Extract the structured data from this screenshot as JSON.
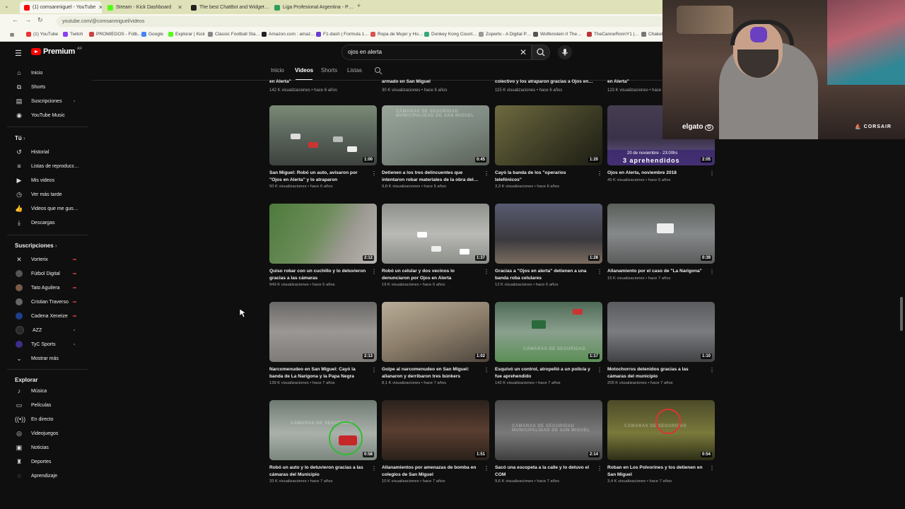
{
  "browser": {
    "tabs": [
      {
        "label": "(1) comsanmiguel - YouTube",
        "color": "#ff0000"
      },
      {
        "label": "Stream - Kick Dashboard",
        "color": "#53fc18"
      },
      {
        "label": "The best ChatBot and Widget…",
        "color": "#222222"
      },
      {
        "label": "Liga Profesional Argentina - P…",
        "color": "#2e9e5a"
      }
    ],
    "url": "youtube.com/@comsanmiguel/videos",
    "bookmarks": [
      "(1) YouTube",
      "Twitch",
      "PROMIEDOS - Fútb…",
      "Google",
      "Explorar | Kick",
      "Classic Football Sta…",
      "Amazon.com : amaz…",
      "F1-dash | Formula 1…",
      "Ropa de Mujer y Ho…",
      "Donkey Kong Count…",
      "Zoperto - A Digital P…",
      "Wolfenstein II The…",
      "TheCanneRonnY1 |…",
      "Chakel"
    ]
  },
  "header": {
    "logo_text": "Premium",
    "country": "AR",
    "search_value": "ojos en alerta"
  },
  "sidebar": {
    "main": [
      {
        "label": "Inicio",
        "icon": "home-icon"
      },
      {
        "label": "Shorts",
        "icon": "shorts-icon"
      },
      {
        "label": "Suscripciones",
        "icon": "subscriptions-icon"
      },
      {
        "label": "YouTube Music",
        "icon": "music-icon"
      }
    ],
    "you_title": "Tú",
    "you": [
      {
        "label": "Historial",
        "icon": "history-icon"
      },
      {
        "label": "Listas de reproducc…",
        "icon": "playlist-icon"
      },
      {
        "label": "Mis videos",
        "icon": "video-icon"
      },
      {
        "label": "Ver más tarde",
        "icon": "clock-icon"
      },
      {
        "label": "Videos que me gus…",
        "icon": "like-icon"
      },
      {
        "label": "Descargas",
        "icon": "download-icon"
      }
    ],
    "subs_title": "Suscripciones",
    "subs": [
      {
        "label": "Vorterix",
        "color": "#222222"
      },
      {
        "label": "Fútbol Digital",
        "color": "#555555"
      },
      {
        "label": "Tato Aguilera",
        "color": "#7a5a48"
      },
      {
        "label": "Cristian Traverso",
        "color": "#666666"
      },
      {
        "label": "Cadena Xeneize",
        "color": "#1e3f8f"
      },
      {
        "label": "AZZ",
        "color": "#2a2a2a"
      },
      {
        "label": "TyC Sports",
        "color": "#3b2f8a"
      }
    ],
    "show_more": "Mostrar más",
    "explore_title": "Explorar",
    "explore": [
      {
        "label": "Música",
        "icon": "music-note-icon"
      },
      {
        "label": "Películas",
        "icon": "film-icon"
      },
      {
        "label": "En directo",
        "icon": "live-icon"
      },
      {
        "label": "Videojuegos",
        "icon": "gamepad-icon"
      },
      {
        "label": "Noticias",
        "icon": "news-icon"
      },
      {
        "label": "Deportes",
        "icon": "trophy-icon"
      },
      {
        "label": "Aprendizaje",
        "icon": "bulb-icon"
      }
    ]
  },
  "channel_tabs": [
    "Inicio",
    "Videos",
    "Shorts",
    "Listas"
  ],
  "top_partial": [
    {
      "title": "en Alerta\"",
      "meta": "142 K visualizaciones • hace 6 años"
    },
    {
      "title": "armado en San Miguel",
      "meta": "30 K visualizaciones • hace 6 años"
    },
    {
      "title": "colectivo y los atraparon gracias a Ojos en…",
      "meta": "115 K visualizaciones • hace 6 años"
    },
    {
      "title": "en Alerta\"",
      "meta": "123 K visualizaciones • hace 6 años"
    }
  ],
  "videos": [
    {
      "title": "San Miguel: Robó un auto, avisaron por \"Ojos en Alerta\" y lo atraparon",
      "meta": "50 K visualizaciones • hace 6 años",
      "duration": "1:00"
    },
    {
      "title": "Detienen a los tres delincuentes que intentaron robar materiales de la obra del…",
      "meta": "9,8 K visualizaciones • hace 6 años",
      "duration": "0:45"
    },
    {
      "title": "Cayó la banda de los \"operarios telefónicos\"",
      "meta": "3,3 K visualizaciones • hace 6 años",
      "duration": "1:20"
    },
    {
      "title": "Ojos en Alerta, noviembre 2018",
      "meta": "45 K visualizaciones • hace 6 años",
      "duration": "2:05"
    },
    {
      "title": "Quiso robar con un cuchillo y lo detuvieron gracias a las cámaras",
      "meta": "949 K visualizaciones • hace 6 años",
      "duration": "2:12"
    },
    {
      "title": "Robó un celular y dos vecinos lo denunciaron por Ojos en Alerta",
      "meta": "19 K visualizaciones • hace 6 años",
      "duration": "1:37"
    },
    {
      "title": "Gracias a \"Ojos en alerta\" detienen a una banda roba celulares",
      "meta": "12 K visualizaciones • hace 6 años",
      "duration": "1:28"
    },
    {
      "title": "Allanamiento por el caso de \"La Narigona\"",
      "meta": "15 K visualizaciones • hace 7 años",
      "duration": "0:39"
    },
    {
      "title": "Narcomenudeo en San Miguel: Cayó la banda de La Narigona y la Papa Negra",
      "meta": "139 K visualizaciones • hace 7 años",
      "duration": "2:13"
    },
    {
      "title": "Golpe al narcomenudeo en San Miguel: allanaron y derribaron tres búnkers",
      "meta": "8,1 K visualizaciones • hace 7 años",
      "duration": "1:02"
    },
    {
      "title": "Esquivó un control, atropelló a un policía y fue aprehendido",
      "meta": "142 K visualizaciones • hace 7 años",
      "duration": "1:17"
    },
    {
      "title": "Motochorros detenidos gracias a las cámaras del municipio",
      "meta": "205 K visualizaciones • hace 7 años",
      "duration": "1:10"
    },
    {
      "title": "Robó un auto y lo detuvieron gracias a las cámaras del Municipio",
      "meta": "33 K visualizaciones • hace 7 años",
      "duration": "0:58"
    },
    {
      "title": "Allanamientos por amenazas de bomba en colegios de San Miguel",
      "meta": "10 K visualizaciones • hace 7 años",
      "duration": "1:51"
    },
    {
      "title": "Sacó una escopeta a la calle y lo detuvo el COM",
      "meta": "9,6 K visualizaciones • hace 7 años",
      "duration": "2:14"
    },
    {
      "title": "Roban en Los Polvorines y los detienen en San Miguel",
      "meta": "3,4 K visualizaciones • hace 7 años",
      "duration": "0:54"
    }
  ],
  "thumb_text": {
    "cameras": "CÁMARAS DE SEGURIDAD",
    "municipality": "MUNICIPALIDAD DE SAN MIGUEL",
    "banner_date": "20 de noviembre - 23:00hs",
    "banner_main": "3 aprehendidos"
  },
  "overlay": {
    "elgato": "elgato",
    "corsair": "CORSAIR"
  }
}
